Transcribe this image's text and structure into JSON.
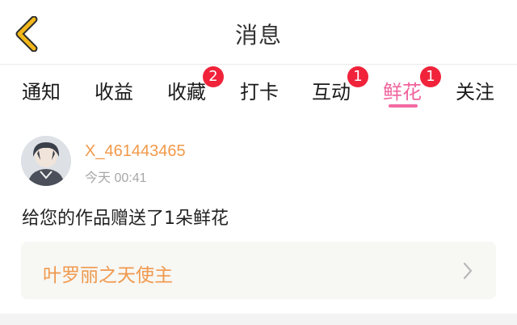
{
  "header": {
    "title": "消息",
    "back_icon": "chevron-left-icon",
    "back_color": "#f2b71a"
  },
  "tabs": [
    {
      "label": "通知",
      "badge": null,
      "active": false
    },
    {
      "label": "收益",
      "badge": null,
      "active": false
    },
    {
      "label": "收藏",
      "badge": "2",
      "active": false
    },
    {
      "label": "打卡",
      "badge": null,
      "active": false
    },
    {
      "label": "互动",
      "badge": "1",
      "active": false
    },
    {
      "label": "鲜花",
      "badge": "1",
      "active": true
    },
    {
      "label": "关注",
      "badge": null,
      "active": false
    }
  ],
  "message": {
    "username": "X_461443465",
    "time": "今天 00:41",
    "content": "给您的作品赠送了1朵鲜花",
    "work_title": "叶罗丽之天使主",
    "avatar_icon": "user-avatar-icon",
    "chevron_icon": "chevron-right-icon"
  },
  "colors": {
    "accent_pink": "#f0629c",
    "badge_red": "#f0233a",
    "orange": "#f2994a"
  }
}
